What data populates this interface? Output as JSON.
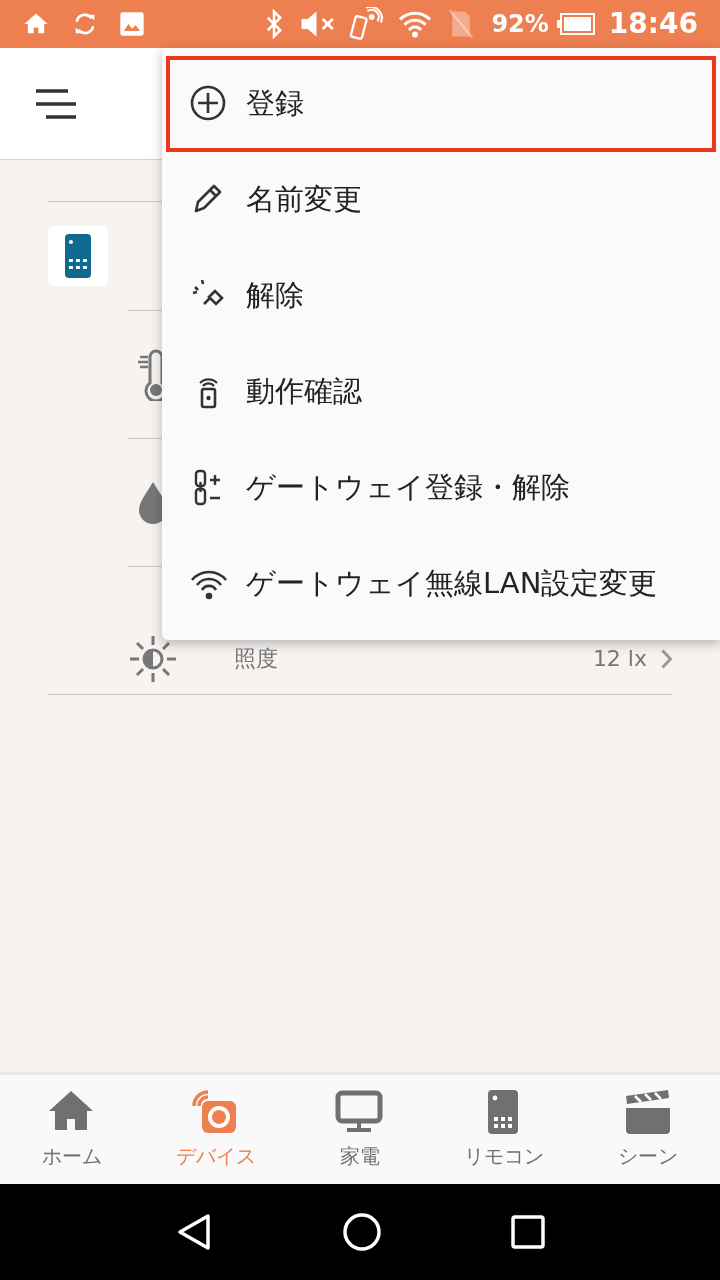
{
  "status_bar": {
    "battery": "92%",
    "time": "18:46"
  },
  "menu": [
    {
      "kind": "add",
      "label": "登録",
      "selected": true
    },
    {
      "kind": "rename",
      "label": "名前変更",
      "selected": false
    },
    {
      "kind": "unlink",
      "label": "解除",
      "selected": false
    },
    {
      "kind": "test",
      "label": "動作確認",
      "selected": false
    },
    {
      "kind": "gateway-link",
      "label": "ゲートウェイ登録・解除",
      "selected": false
    },
    {
      "kind": "gateway-wifi",
      "label": "ゲートウェイ無線LAN設定変更",
      "selected": false
    }
  ],
  "sensor_row": {
    "label": "照度",
    "value": "12 lx"
  },
  "bottom_nav": [
    {
      "kind": "home",
      "label": "ホーム",
      "selected": false
    },
    {
      "kind": "device",
      "label": "デバイス",
      "selected": true
    },
    {
      "kind": "appliance",
      "label": "家電",
      "selected": false
    },
    {
      "kind": "remote",
      "label": "リモコン",
      "selected": false
    },
    {
      "kind": "scene",
      "label": "シーン",
      "selected": false
    }
  ]
}
